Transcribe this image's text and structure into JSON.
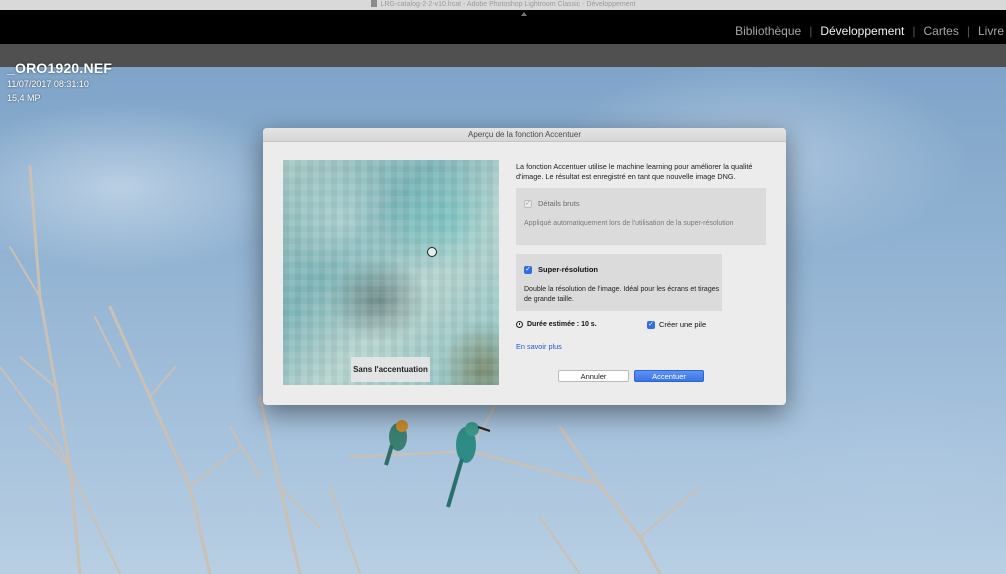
{
  "window": {
    "title": "LRG-catalog-2-2-v10.lrcat - Adobe Photoshop Lightroom Classic - Développement"
  },
  "modules": [
    {
      "label": "Bibliothèque",
      "active": false
    },
    {
      "label": "Développement",
      "active": true
    },
    {
      "label": "Cartes",
      "active": false
    },
    {
      "label": "Livre",
      "active": false
    }
  ],
  "photo": {
    "filename": "_ORO1920.NEF",
    "datetime": "11/07/2017 08:31:10",
    "megapixels": "15,4 MP"
  },
  "dialog": {
    "title": "Aperçu de la fonction Accentuer",
    "preview_caption": "Sans l'accentuation",
    "description": "La fonction Accentuer utilise le machine learning pour améliorer la qualité d'image. Le résultat est enregistré en tant que nouvelle image DNG.",
    "raw_details": {
      "label": "Détails bruts",
      "checked": true,
      "enabled": false,
      "description": "Appliqué automatiquement lors de l'utilisation de la super-résolution"
    },
    "super_resolution": {
      "label": "Super-résolution",
      "checked": true,
      "description": "Double la résolution de l'image. Idéal pour les écrans et tirages de grande taille."
    },
    "duration": "Durée estimée : 10 s.",
    "create_stack": {
      "label": "Créer une pile",
      "checked": true
    },
    "learn_more": "En savoir plus",
    "cancel_label": "Annuler",
    "ok_label": "Accentuer"
  },
  "colors": {
    "accent": "#3a74e6",
    "link": "#2458c7",
    "topbar": "#000000"
  }
}
